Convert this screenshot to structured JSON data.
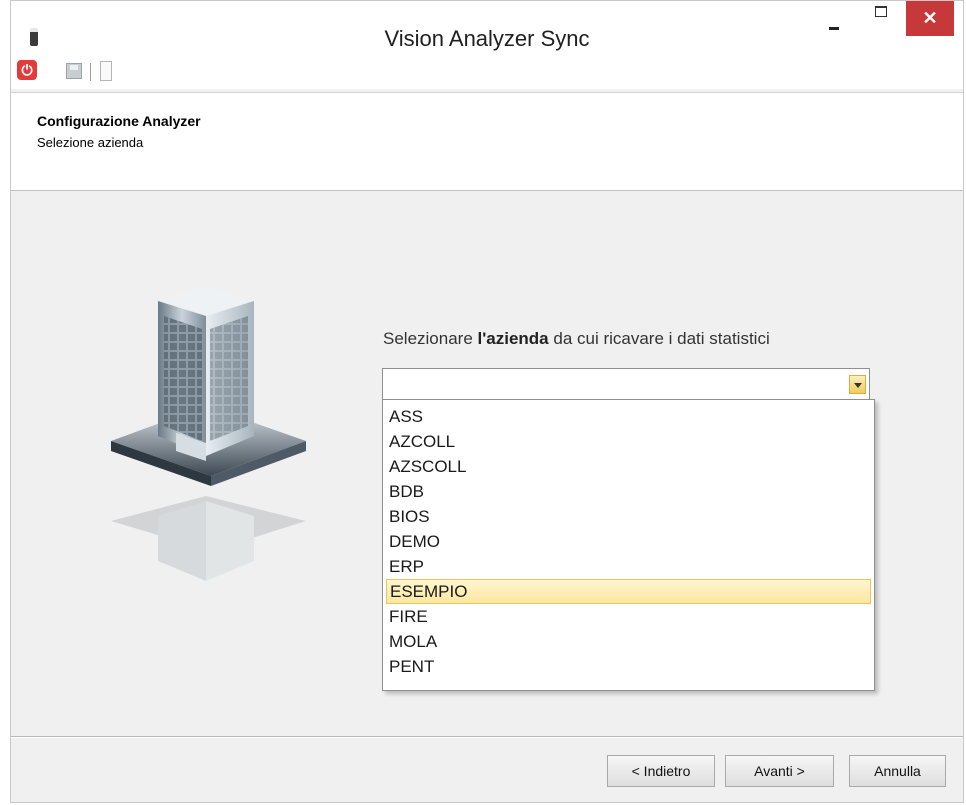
{
  "window": {
    "title": "Vision Analyzer Sync",
    "close_glyph": "✕"
  },
  "toolbar": {
    "power_glyph": "⏻",
    "icons": [
      "power-icon",
      "save-icon",
      "document-icon"
    ]
  },
  "header": {
    "title": "Configurazione Analyzer",
    "subtitle": "Selezione azienda"
  },
  "main": {
    "prompt_before": "Selezionare ",
    "prompt_quote": "l'",
    "prompt_bold": "azienda",
    "prompt_after": " da cui ricavare i dati statistici",
    "combo_value": "",
    "options": [
      "ASS",
      "AZCOLL",
      "AZSCOLL",
      "BDB",
      "BIOS",
      "DEMO",
      "ERP",
      "ESEMPIO",
      "FIRE",
      "MOLA",
      "PENT"
    ],
    "highlighted_option": "ESEMPIO"
  },
  "buttons": {
    "back": "< Indietro",
    "next": "Avanti >",
    "cancel": "Annulla"
  },
  "colors": {
    "close_button": "#c7383a",
    "highlight": "#fde7a0",
    "power_icon": "#e23b3b"
  }
}
